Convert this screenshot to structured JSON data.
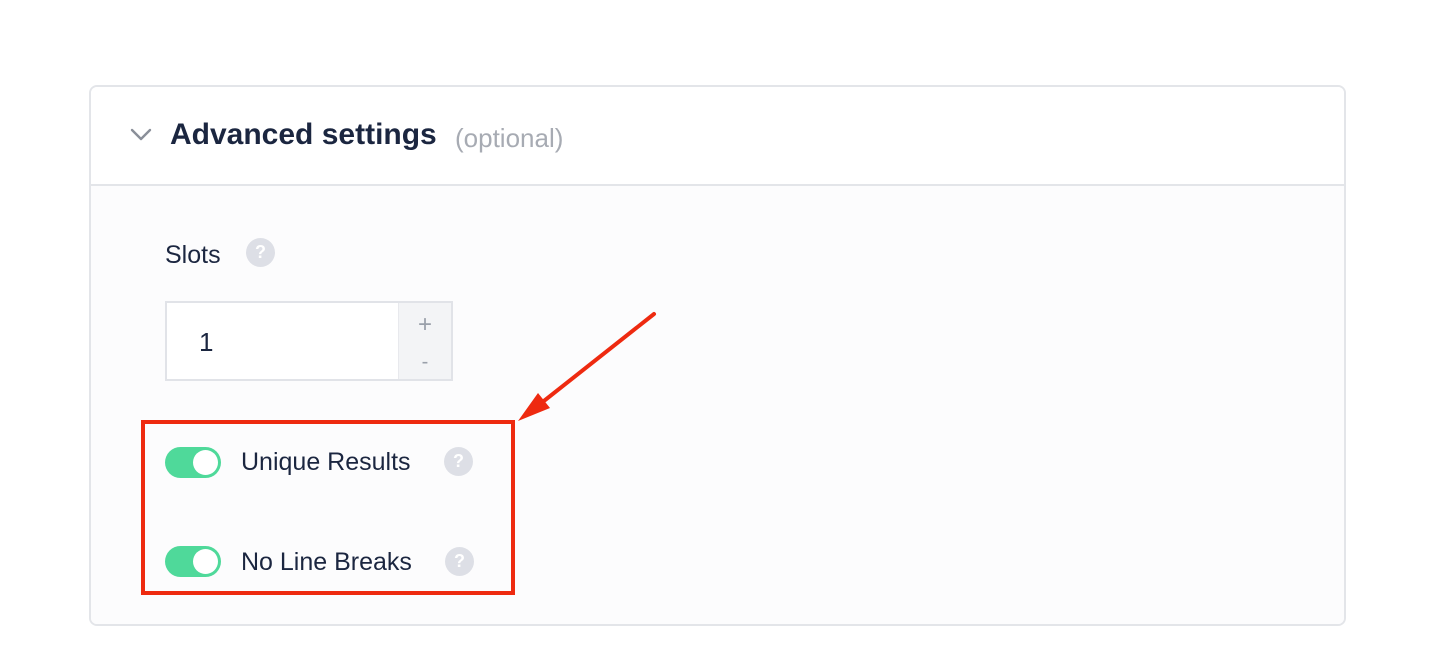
{
  "section": {
    "title": "Advanced settings",
    "optional_label": "(optional)",
    "chevron_icon": "chevron-down-icon"
  },
  "slots": {
    "label": "Slots",
    "value": "1",
    "increment_symbol": "+",
    "decrement_symbol": "-",
    "help_symbol": "?"
  },
  "toggles": [
    {
      "label": "Unique Results",
      "enabled": true,
      "help_symbol": "?"
    },
    {
      "label": "No Line Breaks",
      "enabled": true,
      "help_symbol": "?"
    }
  ],
  "colors": {
    "toggle_on": "#4fd99a",
    "title_text": "#1b2640",
    "annotation_red": "#ee2a10",
    "help_badge": "#dddfe6"
  }
}
